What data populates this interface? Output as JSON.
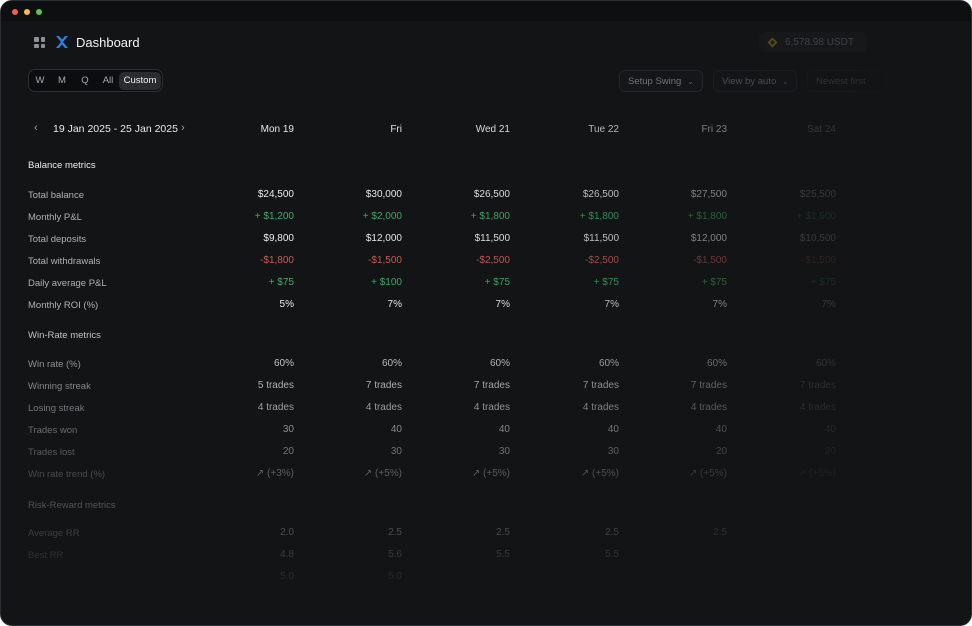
{
  "app": {
    "title": "Dashboard",
    "balance": "6,578.98 USDT"
  },
  "period_tabs": [
    "W",
    "M",
    "Q",
    "All",
    "Custom"
  ],
  "active_tab": "Custom",
  "controls": {
    "setup": "Setup Swing",
    "view": "View by auto",
    "sort": "Newest first"
  },
  "date_range": "19 Jan 2025 - 25 Jan 2025",
  "columns": [
    "Mon 19",
    "Fri",
    "Wed 21",
    "Tue 22",
    "Fri 23",
    "Sat 24"
  ],
  "sections": [
    {
      "title": "Balance metrics",
      "rows": [
        {
          "label": "Total balance",
          "values": [
            "$24,500",
            "$30,000",
            "$26,500",
            "$26,500",
            "$27,500",
            "$25,500"
          ],
          "tone": "neutral"
        },
        {
          "label": "Monthly P&L",
          "values": [
            "+ $1,200",
            "+ $2,000",
            "+ $1,800",
            "+ $1,800",
            "+ $1,800",
            "+ $1,500"
          ],
          "tone": "positive"
        },
        {
          "label": "Total deposits",
          "values": [
            "$9,800",
            "$12,000",
            "$11,500",
            "$11,500",
            "$12,000",
            "$10,500"
          ],
          "tone": "neutral"
        },
        {
          "label": "Total withdrawals",
          "values": [
            "-$1,800",
            "-$1,500",
            "-$2,500",
            "-$2,500",
            "-$1,500",
            "-$1,500"
          ],
          "tone": "negative"
        },
        {
          "label": "Daily average P&L",
          "values": [
            "+ $75",
            "+ $100",
            "+ $75",
            "+ $75",
            "+ $75",
            "+ $75"
          ],
          "tone": "positive"
        },
        {
          "label": "Monthly ROI (%)",
          "values": [
            "5%",
            "7%",
            "7%",
            "7%",
            "7%",
            "7%"
          ],
          "tone": "neutral"
        }
      ]
    },
    {
      "title": "Win-Rate metrics",
      "rows": [
        {
          "label": "Win rate (%)",
          "values": [
            "60%",
            "60%",
            "60%",
            "60%",
            "60%",
            "60%"
          ],
          "tone": "neutral"
        },
        {
          "label": "Winning streak",
          "values": [
            "5 trades",
            "7 trades",
            "7 trades",
            "7 trades",
            "7 trades",
            "7 trades"
          ],
          "tone": "neutral"
        },
        {
          "label": "Losing streak",
          "values": [
            "4 trades",
            "4 trades",
            "4 trades",
            "4 trades",
            "4 trades",
            "4 trades"
          ],
          "tone": "neutral"
        },
        {
          "label": "Trades won",
          "values": [
            "30",
            "40",
            "40",
            "40",
            "40",
            "40"
          ],
          "tone": "neutral"
        },
        {
          "label": "Trades lost",
          "values": [
            "20",
            "30",
            "30",
            "30",
            "20",
            "20"
          ],
          "tone": "neutral"
        },
        {
          "label": "Win rate trend (%)",
          "values": [
            "↗ (+3%)",
            "↗ (+5%)",
            "↗ (+5%)",
            "↗ (+5%)",
            "↗ (+5%)",
            "↗ (+5%)"
          ],
          "tone": "neutral"
        }
      ]
    },
    {
      "title": "Risk-Reward metrics",
      "rows": [
        {
          "label": "Average RR",
          "values": [
            "2.0",
            "2.5",
            "2.5",
            "2.5",
            "2.5",
            ""
          ],
          "tone": "neutral"
        },
        {
          "label": "Best RR",
          "values": [
            "4.8",
            "5.6",
            "5.5",
            "5.5",
            "",
            ""
          ],
          "tone": "neutral"
        },
        {
          "label": "",
          "values": [
            "5.0",
            "5.0",
            "",
            "",
            "",
            ""
          ],
          "tone": "neutral"
        }
      ]
    }
  ],
  "colors": {
    "background": "#121416",
    "positive": "#3fae6a",
    "negative": "#cf5a55",
    "text": "#f2f3f4"
  }
}
